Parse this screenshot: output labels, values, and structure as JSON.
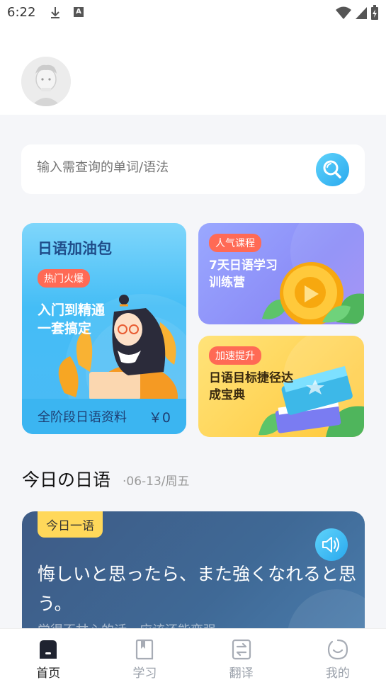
{
  "status": {
    "time": "6:22"
  },
  "search": {
    "placeholder": "输入需查询的单词/语法"
  },
  "cards": {
    "big": {
      "title": "日语加油包",
      "tag": "热门火爆",
      "desc": "入门到精通一套搞定",
      "footer": "全阶段日语资料",
      "price": "￥0"
    },
    "purple": {
      "tag": "人气课程",
      "title": "7天日语学习训练营"
    },
    "yellow": {
      "tag": "加速提升",
      "title": "日语目标捷径达成宝典"
    }
  },
  "today": {
    "title": "今日の日语",
    "date": "·06-13/周五",
    "tag": "今日一语",
    "sentence": "悔しいと思ったら、また強くなれると思う。",
    "translation": "觉得不甘心的话，应该还能变强"
  },
  "tabs": [
    {
      "label": "首页",
      "icon": "home-icon",
      "active": true
    },
    {
      "label": "学习",
      "icon": "book-icon",
      "active": false
    },
    {
      "label": "翻译",
      "icon": "translate-icon",
      "active": false
    },
    {
      "label": "我的",
      "icon": "profile-icon",
      "active": false
    }
  ],
  "colors": {
    "accent": "#2aa9ee",
    "tag_red": "#ff6a55",
    "daily_tag": "#ffd85a"
  }
}
